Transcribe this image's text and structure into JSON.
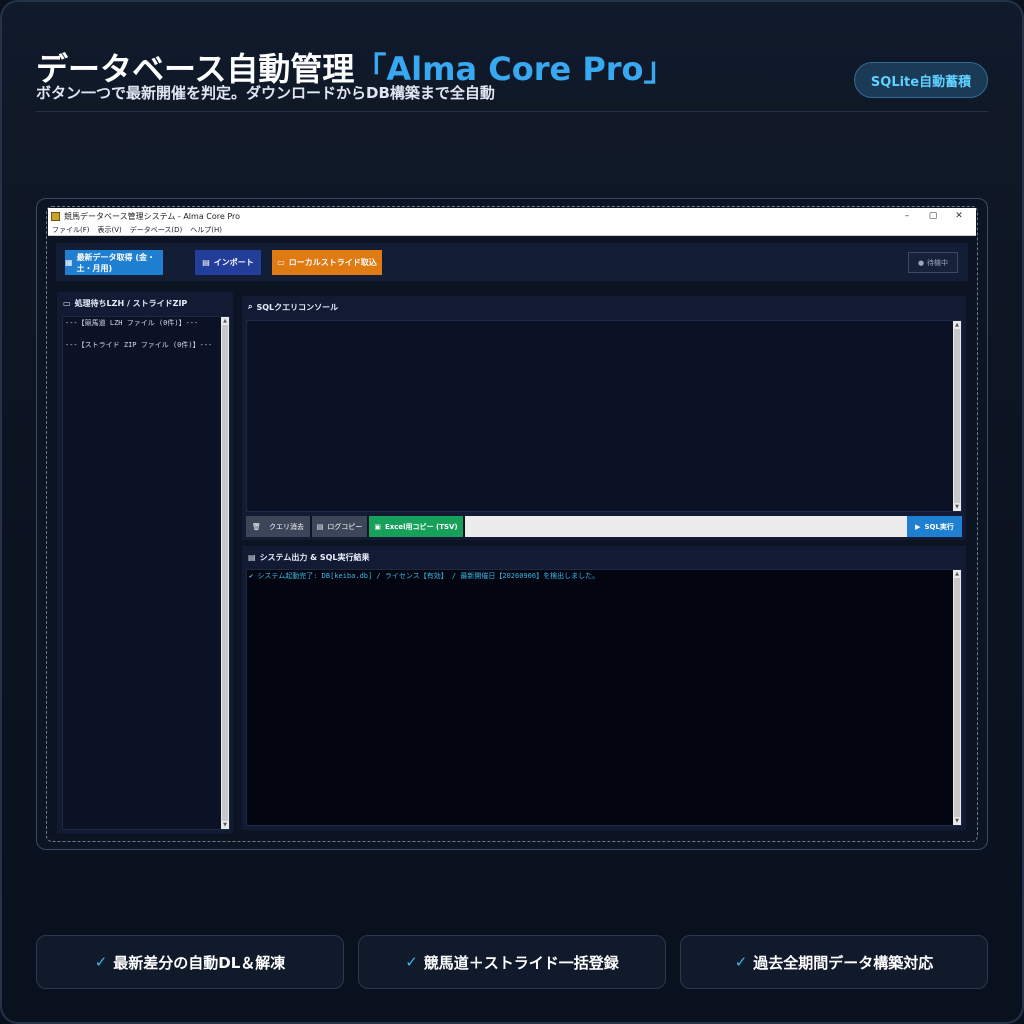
{
  "hero": {
    "title_main": "データベース自動管理",
    "title_accent": "「Alma Core Pro」",
    "subtitle": "ボタン一つで最新開催を判定。ダウンロードからDB構築まで全自動",
    "badge": "SQLite自動蓄積"
  },
  "window": {
    "title": "競馬データベース管理システム - Alma Core Pro",
    "controls": [
      "–",
      "▢",
      "✕"
    ],
    "menu": [
      "ファイル(F)",
      "表示(V)",
      "データベース(D)",
      "ヘルプ(H)"
    ]
  },
  "toolbar": {
    "fetch_label": "最新データ取得 (金・土・月用)",
    "fetch_icon": "calendar-icon",
    "import_label": "インポート",
    "import_icon": "clipboard-icon",
    "local_label": "ローカルストライド取込",
    "local_icon": "folder-icon",
    "status_label": "待機中",
    "colors": {
      "fetch": "#1f7fd0",
      "import": "#223e9a",
      "local": "#e07a12"
    }
  },
  "left_panel": {
    "title": "処理待ちLZH / ストライドZIP",
    "items": [
      "---【競馬道 LZH ファイル (0件)】---",
      "---【ストライド ZIP ファイル (0件)】---"
    ]
  },
  "sql_console": {
    "title": "SQLクエリコンソール",
    "clear_label": "クエリ消去",
    "copy_label": "ログコピー",
    "excel_label": "Excel用コピー (TSV)",
    "run_label": "SQL実行",
    "colors": {
      "excel": "#16a05a",
      "run": "#1f7fd0"
    }
  },
  "output": {
    "title": "システム出力 & SQL実行結果",
    "lines": [
      "✔ システム起動完了: DB[keiba.db] / ライセンス【有効】 / 最新開催日【20260906】を検出しました。"
    ]
  },
  "features": [
    "最新差分の自動DL＆解凍",
    "競馬道＋ストライド一括登録",
    "過去全期間データ構築対応"
  ]
}
